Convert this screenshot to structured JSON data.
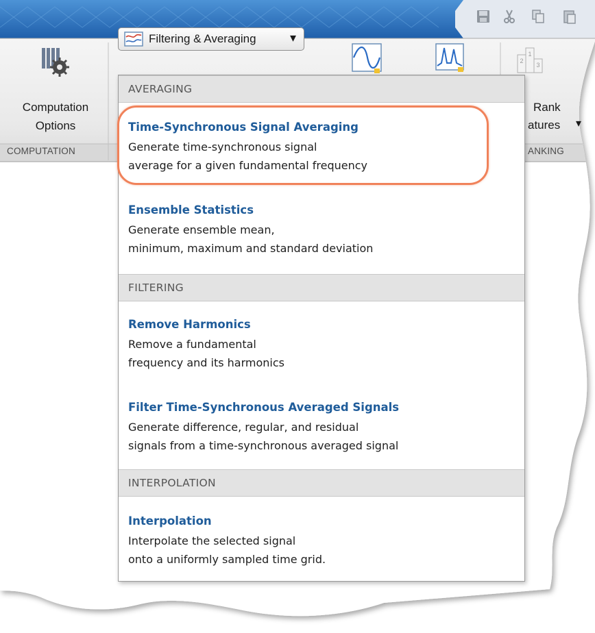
{
  "toolstrip": {
    "computation_options": {
      "line1": "Computation",
      "line2": "Options",
      "icon": "gear-stack-icon"
    },
    "section_computation": "COMPUTATION",
    "filter_dropdown": {
      "label": "Filtering & Averaging",
      "icon": "filter-icon",
      "arrow": "▾"
    },
    "rank_features": {
      "line1": "Rank",
      "line2_partial": "atures",
      "arrow": "▾",
      "icon": "podium-icon"
    },
    "section_ranking_partial": "ANKING",
    "tool_icons": [
      "sine-wave-icon",
      "spectrum-icon"
    ]
  },
  "titlebar": {
    "quick_access_icons": [
      "save-icon",
      "cut-icon",
      "copy-icon",
      "paste-icon"
    ],
    "colors": {
      "gradient_top": "#4a8fd3",
      "gradient_bottom": "#1e5eaa"
    }
  },
  "menu": {
    "sections": [
      {
        "header": "AVERAGING",
        "items": [
          {
            "title": "Time-Synchronous Signal Averaging",
            "desc1": "Generate time-synchronous signal",
            "desc2": "average for a given fundamental frequency",
            "highlighted": true
          },
          {
            "title": "Ensemble Statistics",
            "desc1": "Generate ensemble mean,",
            "desc2": "minimum, maximum and standard deviation"
          }
        ]
      },
      {
        "header": "FILTERING",
        "items": [
          {
            "title": "Remove Harmonics",
            "desc1": "Remove a fundamental",
            "desc2": "frequency and its harmonics"
          },
          {
            "title": "Filter Time-Synchronous Averaged Signals",
            "desc1": "Generate difference, regular, and residual",
            "desc2": "signals from a time-synchronous averaged signal"
          }
        ]
      },
      {
        "header": "INTERPOLATION",
        "items": [
          {
            "title": "Interpolation",
            "desc1": "Interpolate the selected signal",
            "desc2": "onto a uniformly sampled time grid."
          }
        ]
      }
    ],
    "colors": {
      "title": "#1f5c9a",
      "header_bg": "#e3e3e3",
      "highlight_ring": "#f0825a"
    }
  }
}
